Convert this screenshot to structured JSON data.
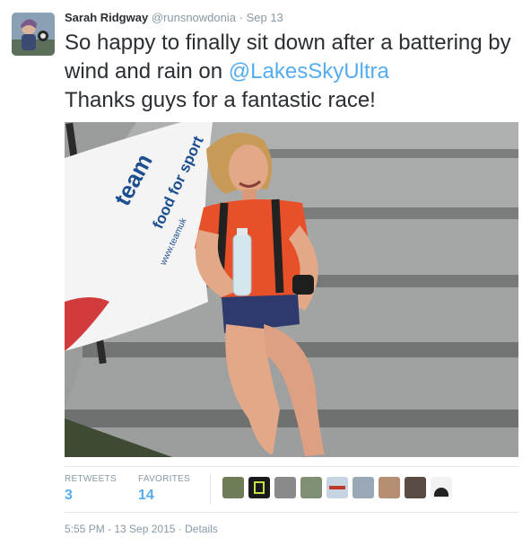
{
  "tweet": {
    "author_name": "Sarah Ridgway",
    "username": "@runsnowdonia",
    "separator": "·",
    "date": "Sep 13",
    "text_line1": "So happy to finally sit down after a battering by wind and rain on ",
    "mention": "@LakesSkyUltra",
    "text_line2": "Thanks guys for a fantastic race!",
    "banner_text_1": "team",
    "banner_text_2": "food for sport",
    "banner_text_3": "www.teamuk"
  },
  "stats": {
    "retweets_label": "RETWEETS",
    "retweets_count": "3",
    "favorites_label": "FAVORITES",
    "favorites_count": "14",
    "favoriter_avatar_count": 9
  },
  "footer": {
    "timestamp": "5:55 PM - 13 Sep 2015",
    "separator": "·",
    "details_label": "Details"
  },
  "colors": {
    "link": "#55acee",
    "muted": "#8899a6",
    "text": "#292f33",
    "shirt": "#e8502a",
    "banner_text": "#1d4e8f"
  }
}
